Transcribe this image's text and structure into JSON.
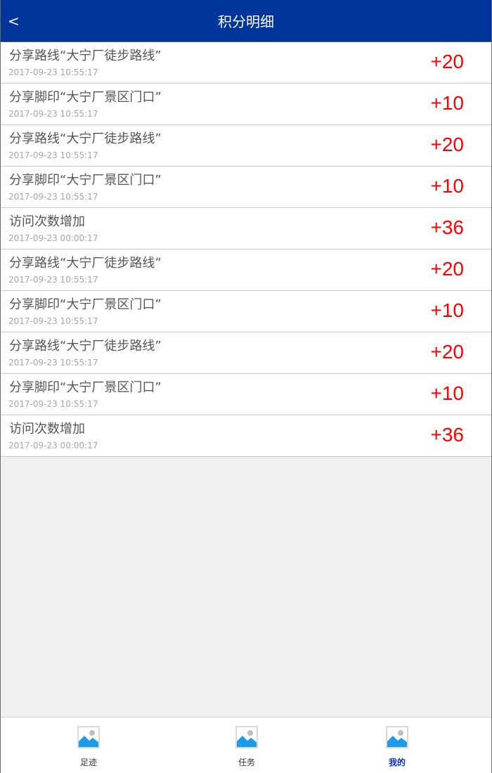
{
  "header": {
    "back_label": "<",
    "title": "积分明细"
  },
  "records": [
    {
      "title": "分享路线“大宁厂徒步路线”",
      "time": "2017-09-23 10:55:17",
      "points": "+20"
    },
    {
      "title": "分享脚印“大宁厂景区门口”",
      "time": "2017-09-23 10:55:17",
      "points": "+10"
    },
    {
      "title": "分享路线“大宁厂徒步路线”",
      "time": "2017-09-23 10:55:17",
      "points": "+20"
    },
    {
      "title": "分享脚印“大宁厂景区门口”",
      "time": "2017-09-23 10:55:17",
      "points": "+10"
    },
    {
      "title": "访问次数增加",
      "time": "2017-09-23 00:00:17",
      "points": "+36"
    },
    {
      "title": "分享路线“大宁厂徒步路线”",
      "time": "2017-09-23 10:55:17",
      "points": "+20"
    },
    {
      "title": "分享脚印“大宁厂景区门口”",
      "time": "2017-09-23 10:55:17",
      "points": "+10"
    },
    {
      "title": "分享路线“大宁厂徒步路线”",
      "time": "2017-09-23 10:55:17",
      "points": "+20"
    },
    {
      "title": "分享脚印“大宁厂景区门口”",
      "time": "2017-09-23 10:55:17",
      "points": "+10"
    },
    {
      "title": "访问次数增加",
      "time": "2017-09-23 00:00:17",
      "points": "+36"
    }
  ],
  "tabbar": {
    "items": [
      {
        "label": "足迹",
        "icon": "image-placeholder-icon",
        "active": false
      },
      {
        "label": "任务",
        "icon": "image-placeholder-icon",
        "active": false
      },
      {
        "label": "我的",
        "icon": "image-placeholder-icon",
        "active": true
      }
    ],
    "active_color": "#0b2fd6"
  },
  "colors": {
    "header_bg": "#00369b",
    "points_color": "#ff0000",
    "page_bg": "#f0f0f0"
  }
}
